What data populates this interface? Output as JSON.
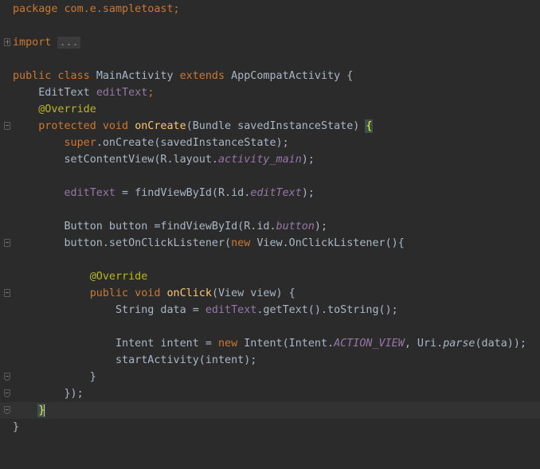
{
  "editor": {
    "line_package": "package com.e.sampletoast;",
    "line_import": "import",
    "folded_imports": "...",
    "class_decl": {
      "mod": "public class",
      "name": "MainActivity",
      "extends": "extends",
      "parent": "AppCompatActivity {"
    },
    "field": {
      "type": "EditText",
      "name": "editText",
      "semi": ";"
    },
    "override_1": "@Override",
    "oncreate_sig": {
      "mod": "protected void",
      "name": "onCreate",
      "params": "(Bundle savedInstanceState) ",
      "brace": "{"
    },
    "super_call": {
      "kw": "super",
      "rest": ".onCreate(savedInstanceState);"
    },
    "set_content": {
      "pre": "setContentView(R.layout.",
      "field": "activity_main",
      "post": ");"
    },
    "assign_edit": {
      "field": "editText",
      "mid": " = findViewById(R.id.",
      "id": "editText",
      "post": ");"
    },
    "button_decl": {
      "pre": "Button button =findViewById(R.id.",
      "id": "button",
      "post": ");"
    },
    "listener": {
      "pre": "button.setOnClickListener(",
      "kw": "new",
      "post": " View.OnClickListener(){"
    },
    "override_2": "@Override",
    "onclick_sig": {
      "mod": "public void",
      "name": "onClick",
      "params": "(View view) {"
    },
    "string_data": {
      "pre": "String data = ",
      "field": "editText",
      "post": ".getText().toString();"
    },
    "intent_line": {
      "pre": "Intent intent = ",
      "kw": "new",
      "mid": " Intent(Intent.",
      "const": "ACTION_VIEW",
      "mid2": ", Uri.",
      "method": "parse",
      "post": "(data));"
    },
    "start_activity": "startActivity(intent);",
    "close_inner": "}",
    "close_listener": "});",
    "close_method": "}",
    "close_class": "}"
  }
}
